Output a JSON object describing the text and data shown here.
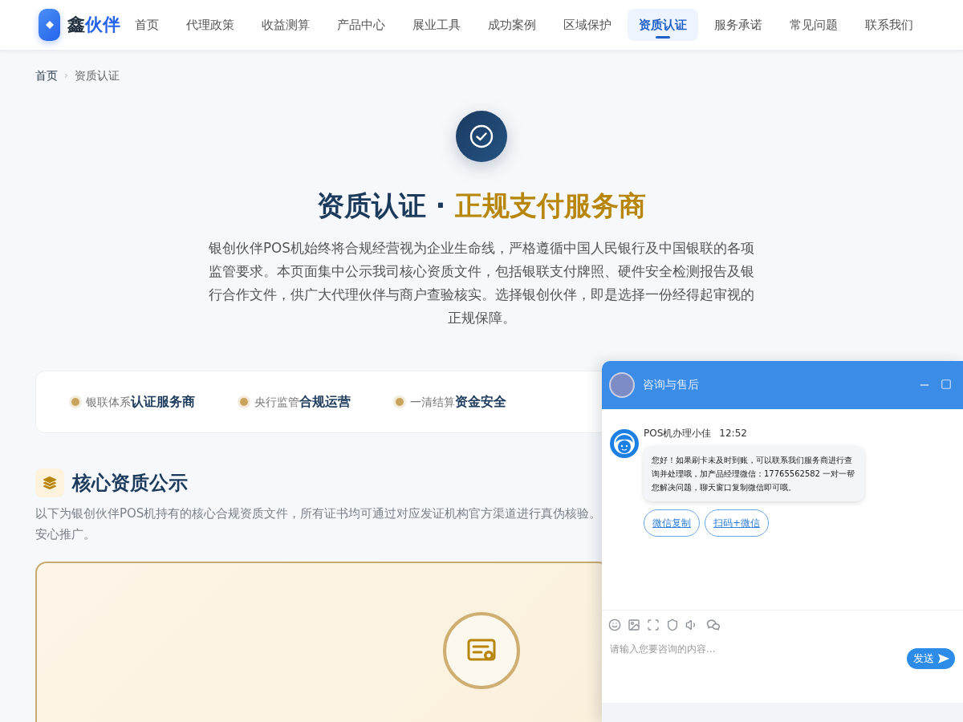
{
  "nav": {
    "logo": {
      "text": "鑫",
      "accent": "伙伴"
    },
    "items": [
      {
        "label": "首页",
        "selected": false
      },
      {
        "label": "代理政策",
        "selected": false
      },
      {
        "label": "收益测算",
        "selected": false
      },
      {
        "label": "产品中心",
        "selected": false
      },
      {
        "label": "展业工具",
        "selected": false
      },
      {
        "label": "成功案例",
        "selected": false
      },
      {
        "label": "区域保护",
        "selected": false
      },
      {
        "label": "资质认证",
        "selected": true
      },
      {
        "label": "服务承诺",
        "selected": false
      },
      {
        "label": "常见问题",
        "selected": false
      },
      {
        "label": "联系我们",
        "selected": false
      }
    ]
  },
  "breadcrumb": {
    "separator": "›",
    "items": [
      {
        "label": "首页",
        "current": false
      },
      {
        "label": "资质认证",
        "current": true
      }
    ]
  },
  "hero": {
    "title": "资质认证",
    "separator": "·",
    "highlight": "正规支付服务商",
    "description": "银创伙伴POS机始终将合规经营视为企业生命线，严格遵循中国人民银行及中国银联的各项监管要求。本页面集中公示我司核心资质文件，包括银联支付牌照、硬件安全检测报告及银行合作文件，供广大代理伙伴与商户查验核实。选择银创伙伴，即是选择一份经得起审视的正规保障。"
  },
  "highlights": [
    {
      "label": "银联体系",
      "value": "认证服务商"
    },
    {
      "label": "央行监管",
      "value": "合规运营"
    },
    {
      "label": "一清结算",
      "value": "资金安全"
    }
  ],
  "section": {
    "title": "核心资质公示",
    "description_lines": [
      "以下为银创伙伴POS机持有的核心合规资质文件，所有证书均可通过对应发证机构官方渠道进行真伪核验。",
      "安心推广。"
    ]
  },
  "chat": {
    "title": "咨询与售后",
    "messages": [
      {
        "sender": "POS机办理小佳",
        "time": "12:52",
        "text": "您好！如果刷卡未及时到账，可以联系我们服务商进行查询并处理哦，加产品经理微信：17765562582 一对一帮您解决问题，聊天窗口复制微信即可哦。",
        "actions": [
          "微信复制",
          "扫码+微信"
        ]
      }
    ],
    "input": {
      "placeholder": "请输入您要咨询的内容..."
    },
    "send_label": "发送"
  }
}
